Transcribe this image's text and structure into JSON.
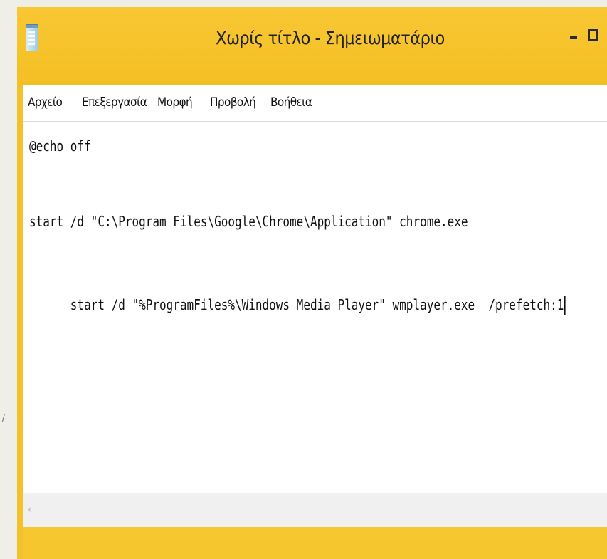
{
  "window": {
    "title": "Χωρίς τίτλο - Σημειωματάριο",
    "accent_color": "#f6c62f"
  },
  "icons": {
    "app": "notepad-icon",
    "minimize": "minimize-icon",
    "maximize": "maximize-icon",
    "scroll_left": "chevron-left-icon"
  },
  "menu": {
    "items": [
      "Αρχείο",
      "Επεξεργασία",
      "Μορφή",
      "Προβολή",
      "Βοήθεια"
    ]
  },
  "editor": {
    "lines": [
      "@echo off",
      "",
      "",
      "start /d \"C:\\Program Files\\Google\\Chrome\\Application\" chrome.exe",
      "",
      "",
      "start /d \"%ProgramFiles%\\Windows Media Player\" wmplayer.exe  /prefetch:1"
    ]
  },
  "scrollbar": {
    "left_arrow": "‹"
  }
}
